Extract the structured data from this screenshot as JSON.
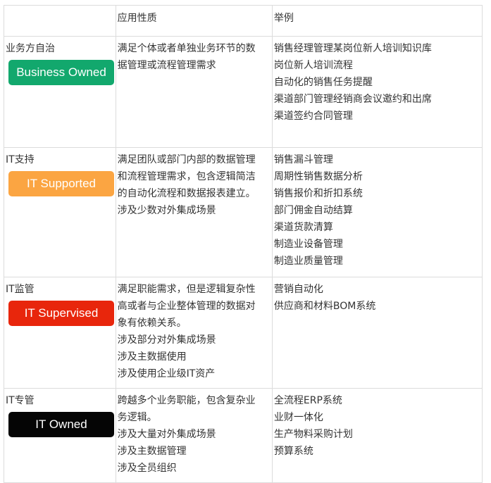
{
  "header": {
    "col1": "",
    "col2": "应用性质",
    "col3": "举例"
  },
  "rows": [
    {
      "category": "业务方自治",
      "badge": "Business Owned",
      "badge_color": "#12a86d",
      "nature": [
        "满足个体或者单独业务环节的数",
        "据管理或流程管理需求"
      ],
      "examples": [
        "销售经理管理某岗位新人培训知识库",
        "岗位新人培训流程",
        "自动化的销售任务提醒",
        "渠道部门管理经销商会议邀约和出席",
        "渠道签约合同管理"
      ]
    },
    {
      "category": "IT支持",
      "badge": "IT Supported",
      "badge_color": "#fba542",
      "nature": [
        "满足团队或部门内部的数据管理",
        "和流程管理需求，包含逻辑简洁",
        "的自动化流程和数据报表建立。",
        "涉及少数对外集成场景"
      ],
      "examples": [
        "销售漏斗管理",
        "周期性销售数据分析",
        "销售报价和折扣系统",
        "部门佣金自动结算",
        "渠道货款清算",
        "制造业设备管理",
        "制造业质量管理"
      ]
    },
    {
      "category": "IT监管",
      "badge": "IT Supervised",
      "badge_color": "#e8260c",
      "nature": [
        "满足职能需求，但是逻辑复杂性",
        "高或者与企业整体管理的数据对",
        "象有依赖关系。",
        "涉及部分对外集成场景",
        "涉及主数据使用",
        "涉及使用企业级IT资产"
      ],
      "examples": [
        "营销自动化",
        "供应商和材料BOM系统"
      ]
    },
    {
      "category": "IT专管",
      "badge": "IT Owned",
      "badge_color": "#050505",
      "nature": [
        "跨越多个业务职能，包含复杂业",
        "务逻辑。",
        "涉及大量对外集成场景",
        "涉及主数据管理",
        "涉及全员组织"
      ],
      "examples": [
        "全流程ERP系统",
        "业财一体化",
        "生产物料采购计划",
        "预算系统"
      ]
    }
  ]
}
